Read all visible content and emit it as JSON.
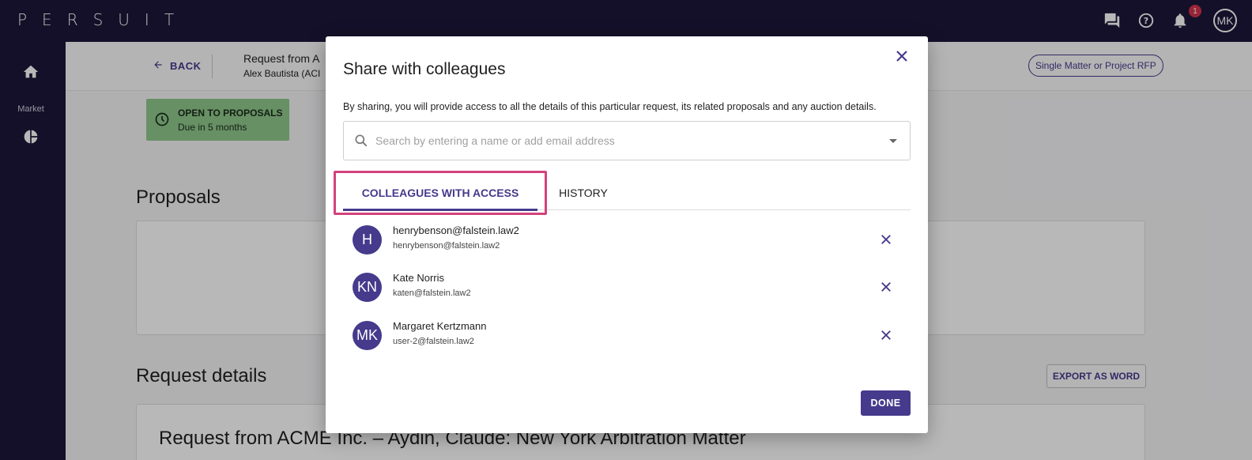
{
  "app": {
    "logo": "PERSUIT"
  },
  "topbar": {
    "notification_count": "1",
    "user_initials": "MK"
  },
  "sidebar": {
    "market_label": "Market"
  },
  "page": {
    "back_label": "BACK",
    "request_title": "Request from A",
    "request_sub": "Alex Bautista (ACI",
    "pill_label": "Single Matter or Project RFP",
    "status_title": "OPEN TO PROPOSALS",
    "status_sub": "Due in 5 months",
    "proposals_heading": "Proposals",
    "details_heading": "Request details",
    "export_label": "EXPORT AS WORD",
    "request_full_title": "Request from ACME Inc. – Aydin, Claude: New York Arbitration Matter"
  },
  "modal": {
    "title": "Share with colleagues",
    "description": "By sharing, you will provide access to all the details of this particular request, its related proposals and any auction details.",
    "search_placeholder": "Search by entering a name or add email address",
    "tabs": [
      "COLLEAGUES WITH ACCESS",
      "HISTORY"
    ],
    "colleagues": [
      {
        "initials": "H",
        "name": "henrybenson@falstein.law2",
        "email": "henrybenson@falstein.law2"
      },
      {
        "initials": "KN",
        "name": "Kate Norris",
        "email": "katen@falstein.law2"
      },
      {
        "initials": "MK",
        "name": "Margaret Kertzmann",
        "email": "user-2@falstein.law2"
      }
    ],
    "done_label": "DONE"
  },
  "colors": {
    "brand": "#453a8c",
    "nav": "#1d1739",
    "highlight": "#d3427c",
    "status": "#8fc88b"
  }
}
